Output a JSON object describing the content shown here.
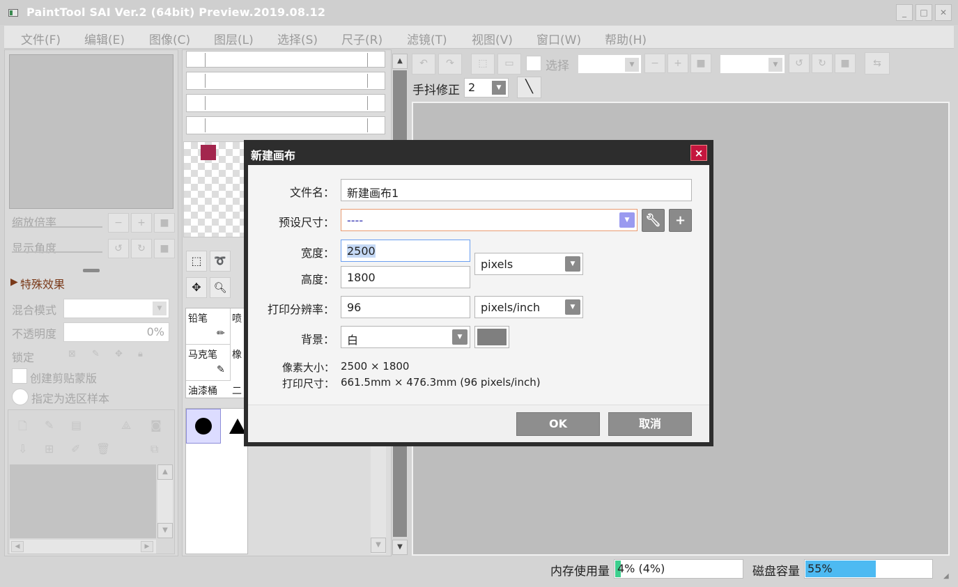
{
  "window": {
    "title": "PaintTool SAI Ver.2 (64bit) Preview.2019.08.12",
    "minimize": "_",
    "maximize": "□",
    "close": "✕"
  },
  "menu": [
    "文件(F)",
    "编辑(E)",
    "图像(C)",
    "图层(L)",
    "选择(S)",
    "尺子(R)",
    "滤镜(T)",
    "视图(V)",
    "窗口(W)",
    "帮助(H)"
  ],
  "left_panel": {
    "zoom_label": "缩放倍率",
    "angle_label": "显示角度",
    "effects_label": "特殊效果",
    "blend_label": "混合模式",
    "opacity_label": "不透明度",
    "opacity_value": "0%",
    "lock_label": "锁定",
    "clip_label": "创建剪贴蒙版",
    "sample_label": "指定为选区样本"
  },
  "tools": {
    "pencil": "铅笔",
    "airbrush": "喷",
    "marker": "马克笔",
    "eraser": "橡",
    "bucket": "油漆桶",
    "binary": "二"
  },
  "toolbar": {
    "select_label": "选择",
    "stabilizer_label": "手抖修正",
    "stabilizer_value": "2"
  },
  "status": {
    "memory_label": "内存使用量",
    "memory_value": "4% (4%)",
    "memory_fraction": 0.04,
    "disk_label": "磁盘容量",
    "disk_value": "55%",
    "disk_fraction": 0.55,
    "memory_color": "#3ccf8e",
    "disk_color": "#4dbaf2"
  },
  "dialog": {
    "title": "新建画布",
    "filename_label": "文件名：",
    "filename_value": "新建画布1",
    "preset_label": "预设尺寸：",
    "preset_value": "----",
    "width_label": "宽度：",
    "width_value": "2500",
    "height_label": "高度：",
    "height_value": "1800",
    "size_unit": "pixels",
    "dpi_label": "打印分辨率：",
    "dpi_value": "96",
    "dpi_unit": "pixels/inch",
    "bg_label": "背景：",
    "bg_value": "白",
    "pixel_size_label": "像素大小：",
    "pixel_size_value": "2500 × 1800",
    "print_size_label": "打印尺寸：",
    "print_size_value": "661.5mm × 476.3mm (96 pixels/inch)",
    "ok": "OK",
    "cancel": "取消",
    "close": "×",
    "accent": "#c4163e"
  }
}
